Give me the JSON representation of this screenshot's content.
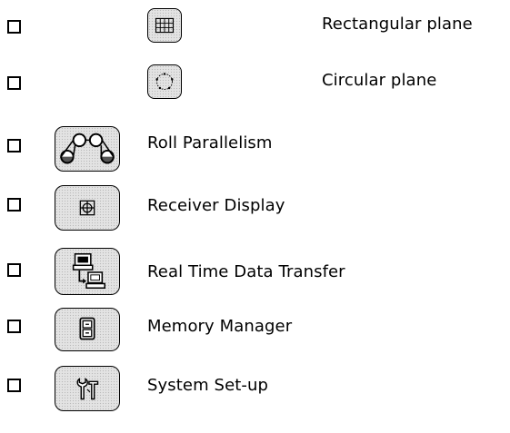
{
  "items": [
    {
      "label": "Rectangular plane",
      "icon": "grid-icon"
    },
    {
      "label": "Circular plane",
      "icon": "circle-dots-icon"
    },
    {
      "label": "Roll Parallelism",
      "icon": "rollers-icon"
    },
    {
      "label": "Receiver Display",
      "icon": "crosshair-icon"
    },
    {
      "label": "Real Time Data Transfer",
      "icon": "computer-transfer-icon"
    },
    {
      "label": "Memory Manager",
      "icon": "filing-cabinet-icon"
    },
    {
      "label": "System Set-up",
      "icon": "tools-icon"
    }
  ]
}
